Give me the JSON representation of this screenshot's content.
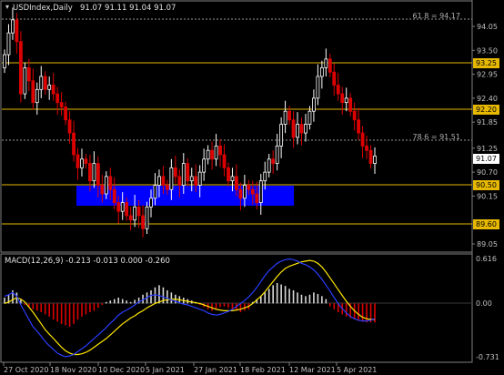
{
  "main_chart": {
    "header": {
      "symbol": "USDIndex,Daily",
      "ohlc": "91.07 91.11 91.04 91.07"
    },
    "fib_labels": {
      "top": "61.8 = 94.17",
      "mid": "78.6 = 91.51"
    },
    "price_axis_ticks": [
      "94.05",
      "93.50",
      "92.95",
      "92.40",
      "91.85",
      "91.25",
      "90.70",
      "90.15",
      "89.05"
    ],
    "level_tags": [
      "93.25",
      "92.20",
      "90.50",
      "89.60"
    ],
    "current_price": "91.07",
    "date_axis_ticks": [
      "27 Oct 2020",
      "18 Nov 2020",
      "10 Dec 2020",
      "5 Jan 2021",
      "27 Jan 2021",
      "18 Feb 2021",
      "12 Mar 2021",
      "5 Apr 2021"
    ]
  },
  "macd": {
    "header": "MACD(12,26,9) -0.213 -0.013 0.000 -0.260",
    "axis_ticks": [
      "0.616",
      "0.00",
      "-0.731"
    ]
  },
  "colors": {
    "background": "#000000",
    "bull_candle": "#ffffff",
    "bear_candle": "#dd0000",
    "level_line": "#e6b800",
    "support_zone": "#0000ff",
    "macd_signal": "#ffe600",
    "macd_line": "#2a3dff",
    "text": "#c0c0c0"
  },
  "chart_data": [
    {
      "type": "candlestick",
      "title": "USDIndex,Daily",
      "x_axis": [
        "27 Oct 2020",
        "18 Nov 2020",
        "10 Dec 2020",
        "5 Jan 2021",
        "27 Jan 2021",
        "18 Feb 2021",
        "12 Mar 2021",
        "5 Apr 2021"
      ],
      "ylim": [
        88.9,
        94.55
      ],
      "grid": false,
      "horizontal_levels": [
        93.25,
        92.2,
        90.5,
        89.6
      ],
      "fib_levels": [
        {
          "label": "61.8",
          "value": 94.17
        },
        {
          "label": "78.6",
          "value": 91.51
        }
      ],
      "support_zone": [
        90.07,
        90.43
      ],
      "closes": [
        93.4,
        93.9,
        94.2,
        93.7,
        92.5,
        93.1,
        92.8,
        92.3,
        92.6,
        92.9,
        92.6,
        92.7,
        92.5,
        92.3,
        92.2,
        91.9,
        91.6,
        91.1,
        90.8,
        91.0,
        90.9,
        90.5,
        90.9,
        90.4,
        90.2,
        90.6,
        90.3,
        90.0,
        89.8,
        90.0,
        89.7,
        89.6,
        89.9,
        89.7,
        89.4,
        89.9,
        90.1,
        90.4,
        90.6,
        90.4,
        90.3,
        90.8,
        90.6,
        90.4,
        90.9,
        90.5,
        90.6,
        90.4,
        90.7,
        91.0,
        91.2,
        91.0,
        91.3,
        91.1,
        90.8,
        90.5,
        90.6,
        90.3,
        90.1,
        90.4,
        90.3,
        90.2,
        90.0,
        90.5,
        90.7,
        91.0,
        90.9,
        91.3,
        91.8,
        92.1,
        91.9,
        91.5,
        91.8,
        91.6,
        91.8,
        92.1,
        92.4,
        92.9,
        93.1,
        93.3,
        93.0,
        92.7,
        92.5,
        92.3,
        92.4,
        92.1,
        91.9,
        91.6,
        91.3,
        91.2,
        90.9,
        91.07
      ],
      "y_label": "",
      "x_label": ""
    },
    {
      "type": "bar",
      "title": "MACD(12,26,9) -0.213 -0.013 0.000 -0.260",
      "ylim": [
        -0.731,
        0.616
      ],
      "histogram": [
        0.08,
        0.12,
        0.18,
        0.15,
        0.05,
        -0.02,
        -0.05,
        -0.08,
        -0.1,
        -0.12,
        -0.15,
        -0.18,
        -0.22,
        -0.25,
        -0.28,
        -0.3,
        -0.32,
        -0.28,
        -0.22,
        -0.18,
        -0.15,
        -0.12,
        -0.1,
        -0.06,
        -0.02,
        0.02,
        0.04,
        0.06,
        0.08,
        0.06,
        0.04,
        0.02,
        0.05,
        0.08,
        0.12,
        0.15,
        0.18,
        0.22,
        0.25,
        0.22,
        0.18,
        0.15,
        0.12,
        0.1,
        0.08,
        0.06,
        0.04,
        0.02,
        -0.02,
        -0.05,
        -0.08,
        -0.1,
        -0.08,
        -0.05,
        -0.04,
        -0.06,
        -0.08,
        -0.1,
        -0.12,
        -0.1,
        -0.08,
        0.02,
        0.06,
        0.1,
        0.15,
        0.2,
        0.25,
        0.28,
        0.26,
        0.24,
        0.2,
        0.18,
        0.15,
        0.12,
        0.1,
        0.12,
        0.15,
        0.13,
        0.1,
        0.06,
        -0.04,
        -0.08,
        -0.12,
        -0.15,
        -0.18,
        -0.2,
        -0.22,
        -0.24,
        -0.25,
        -0.26,
        -0.26,
        -0.26
      ],
      "signal": [
        0.0,
        0.02,
        0.05,
        0.08,
        0.06,
        0.02,
        -0.05,
        -0.12,
        -0.2,
        -0.28,
        -0.36,
        -0.42,
        -0.48,
        -0.54,
        -0.6,
        -0.65,
        -0.68,
        -0.7,
        -0.7,
        -0.69,
        -0.67,
        -0.64,
        -0.6,
        -0.56,
        -0.52,
        -0.48,
        -0.43,
        -0.38,
        -0.33,
        -0.28,
        -0.24,
        -0.2,
        -0.17,
        -0.13,
        -0.1,
        -0.06,
        -0.03,
        0.0,
        0.02,
        0.04,
        0.05,
        0.06,
        0.06,
        0.05,
        0.04,
        0.03,
        0.02,
        0.01,
        0.0,
        -0.02,
        -0.04,
        -0.06,
        -0.08,
        -0.09,
        -0.1,
        -0.1,
        -0.1,
        -0.09,
        -0.08,
        -0.06,
        -0.04,
        0.0,
        0.05,
        0.1,
        0.16,
        0.23,
        0.3,
        0.37,
        0.43,
        0.48,
        0.51,
        0.53,
        0.55,
        0.57,
        0.58,
        0.59,
        0.58,
        0.55,
        0.5,
        0.43,
        0.35,
        0.27,
        0.19,
        0.11,
        0.03,
        -0.04,
        -0.1,
        -0.15,
        -0.19,
        -0.21,
        -0.22,
        -0.22
      ],
      "macd": [
        0.1,
        0.12,
        0.15,
        0.1,
        -0.02,
        -0.12,
        -0.22,
        -0.32,
        -0.38,
        -0.45,
        -0.52,
        -0.58,
        -0.63,
        -0.68,
        -0.71,
        -0.73,
        -0.72,
        -0.7,
        -0.66,
        -0.62,
        -0.58,
        -0.53,
        -0.48,
        -0.43,
        -0.38,
        -0.33,
        -0.27,
        -0.22,
        -0.16,
        -0.12,
        -0.09,
        -0.06,
        -0.02,
        0.02,
        0.05,
        0.08,
        0.11,
        0.12,
        0.11,
        0.09,
        0.07,
        0.05,
        0.03,
        0.01,
        -0.01,
        -0.02,
        -0.04,
        -0.06,
        -0.08,
        -0.1,
        -0.13,
        -0.15,
        -0.16,
        -0.15,
        -0.13,
        -0.11,
        -0.08,
        -0.04,
        0.0,
        0.04,
        0.09,
        0.15,
        0.22,
        0.3,
        0.38,
        0.45,
        0.5,
        0.55,
        0.58,
        0.6,
        0.61,
        0.6,
        0.58,
        0.55,
        0.53,
        0.5,
        0.46,
        0.4,
        0.33,
        0.25,
        0.17,
        0.08,
        0.0,
        -0.07,
        -0.13,
        -0.18,
        -0.21,
        -0.23,
        -0.24,
        -0.24,
        -0.23,
        -0.21
      ]
    }
  ]
}
